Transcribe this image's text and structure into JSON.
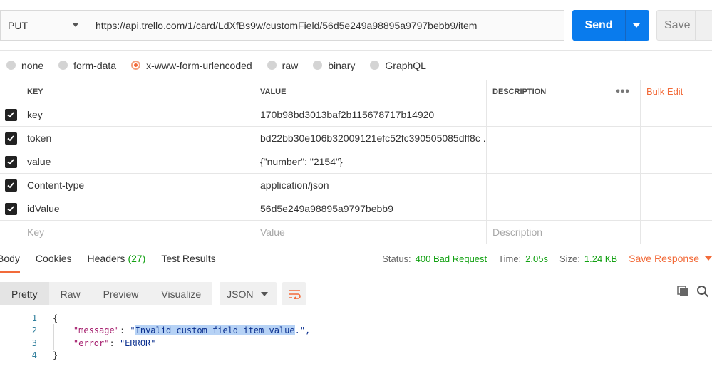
{
  "request": {
    "method": "PUT",
    "url": "https://api.trello.com/1/card/LdXfBs9w/customField/56d5e249a98895a9797bebb9/item",
    "send_label": "Send",
    "save_label": "Save"
  },
  "body_types": [
    {
      "label": "none",
      "selected": false
    },
    {
      "label": "form-data",
      "selected": false
    },
    {
      "label": "x-www-form-urlencoded",
      "selected": true
    },
    {
      "label": "raw",
      "selected": false
    },
    {
      "label": "binary",
      "selected": false
    },
    {
      "label": "GraphQL",
      "selected": false
    }
  ],
  "params_table": {
    "headers": {
      "key": "KEY",
      "value": "VALUE",
      "description": "DESCRIPTION",
      "bulk_edit": "Bulk Edit"
    },
    "rows": [
      {
        "key": "key",
        "value": "170b98bd3013baf2b115678717b14920",
        "description": "",
        "checked": true
      },
      {
        "key": "token",
        "value": "bd22bb30e106b32009121efc52fc390505085dff8c ...",
        "description": "",
        "checked": true
      },
      {
        "key": "value",
        "value": "{\"number\": \"2154\"}",
        "description": "",
        "checked": true
      },
      {
        "key": "Content-type",
        "value": "application/json",
        "description": "",
        "checked": true
      },
      {
        "key": "idValue",
        "value": "56d5e249a98895a9797bebb9",
        "description": "",
        "checked": true
      }
    ],
    "placeholders": {
      "key": "Key",
      "value": "Value",
      "description": "Description"
    }
  },
  "response": {
    "tabs": [
      {
        "label": "Body",
        "active": true
      },
      {
        "label": "Cookies",
        "active": false
      },
      {
        "label": "Headers",
        "count": "(27)",
        "active": false
      },
      {
        "label": "Test Results",
        "active": false
      }
    ],
    "status_label": "Status:",
    "status_value": "400 Bad Request",
    "time_label": "Time:",
    "time_value": "2.05s",
    "size_label": "Size:",
    "size_value": "1.24 KB",
    "save_response": "Save Response"
  },
  "format": {
    "options": [
      "Pretty",
      "Raw",
      "Preview",
      "Visualize"
    ],
    "active": "Pretty",
    "language": "JSON"
  },
  "code": {
    "line_numbers": [
      "1",
      "2",
      "3",
      "4"
    ],
    "open_brace": "{",
    "message_key": "\"message\"",
    "message_quote_open": "\"",
    "message_selected": "Invalid custom field item value",
    "message_tail": ".\",",
    "error_key": "\"error\"",
    "error_value": "\"ERROR\"",
    "close_brace": "}"
  },
  "colors": {
    "accent": "#f26b3a",
    "send": "#097bed",
    "status_ok_green": "#12a112"
  }
}
